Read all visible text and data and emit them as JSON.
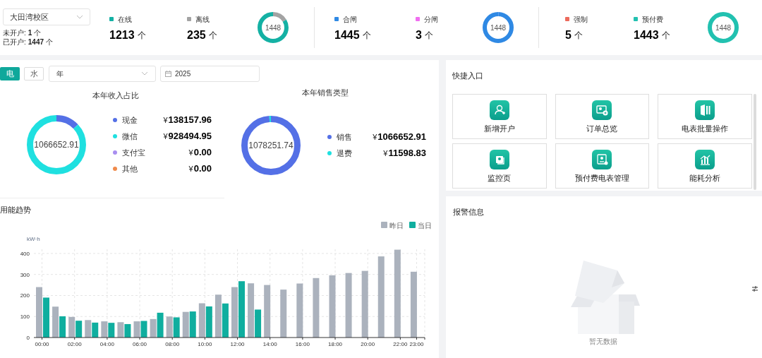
{
  "top_bar": {
    "campus_select": {
      "value": "大田湾校区"
    },
    "account_counts": [
      {
        "label": "未开户:",
        "count": "1",
        "unit": "个"
      },
      {
        "label": "已开户:",
        "count": "1447",
        "unit": "个"
      }
    ],
    "stat_groups": [
      {
        "items": [
          {
            "label": "在线",
            "color": "#14b1a4",
            "value": "1213",
            "unit": "个"
          },
          {
            "label": "离线",
            "color": "#a3a3a3",
            "value": "235",
            "unit": "个"
          }
        ],
        "donut_center": "1448"
      },
      {
        "items": [
          {
            "label": "合闸",
            "color": "#2f89e4",
            "value": "1445",
            "unit": "个"
          },
          {
            "label": "分闸",
            "color": "#f06ef0",
            "value": "3",
            "unit": "个"
          }
        ],
        "donut_center": "1448"
      },
      {
        "items": [
          {
            "label": "强制",
            "color": "#ec6a5c",
            "value": "5",
            "unit": "个"
          },
          {
            "label": "预付费",
            "color": "#22c1b0",
            "value": "1443",
            "unit": "个"
          }
        ],
        "donut_center": "1448"
      }
    ]
  },
  "filters": {
    "energy_tabs": [
      {
        "label": "电",
        "selected": true
      },
      {
        "label": "水",
        "selected": false
      }
    ],
    "period_select": {
      "value": "年"
    },
    "date_field": {
      "value": "2025"
    }
  },
  "income_share": {
    "title": "本年收入占比",
    "center": "1066652.91",
    "items": [
      {
        "label": "现金",
        "color": "#5470e6",
        "currency": "¥",
        "amount": "138157.96"
      },
      {
        "label": "微信",
        "color": "#1fe0e0",
        "currency": "¥",
        "amount": "928494.95"
      },
      {
        "label": "支付宝",
        "color": "#a98ef0",
        "currency": "¥",
        "amount": "0.00"
      },
      {
        "label": "其他",
        "color": "#f08a4b",
        "currency": "¥",
        "amount": "0.00"
      }
    ]
  },
  "sales_type": {
    "title": "本年销售类型",
    "center": "1078251.74",
    "items": [
      {
        "label": "销售",
        "color": "#5470e6",
        "currency": "¥",
        "amount": "1066652.91"
      },
      {
        "label": "退费",
        "color": "#1fe0e0",
        "currency": "¥",
        "amount": "11598.83"
      }
    ]
  },
  "energy_trend": {
    "title": "用能趋势",
    "chart_data": {
      "type": "bar",
      "ylabel": "kW·h",
      "x": [
        0,
        1,
        2,
        3,
        4,
        5,
        6,
        7,
        8,
        9,
        10,
        11,
        12,
        13,
        14,
        15,
        16,
        17,
        18,
        19,
        20,
        21,
        22,
        23
      ],
      "xlim": [
        -0.5,
        23.5
      ],
      "ylim": [
        0,
        420
      ],
      "grid": {
        "x": true,
        "y": true
      },
      "legend": true,
      "yticks": [
        0,
        100,
        200,
        300,
        400
      ],
      "xticks": [
        {
          "value": 0,
          "label": "00:00"
        },
        {
          "value": 2,
          "label": "02:00"
        },
        {
          "value": 4,
          "label": "04:00"
        },
        {
          "value": 6,
          "label": "06:00"
        },
        {
          "value": 8,
          "label": "08:00"
        },
        {
          "value": 10,
          "label": "10:00"
        },
        {
          "value": 12,
          "label": "12:00"
        },
        {
          "value": 14,
          "label": "14:00"
        },
        {
          "value": 16,
          "label": "16:00"
        },
        {
          "value": 18,
          "label": "18:00"
        },
        {
          "value": 20,
          "label": "20:00"
        },
        {
          "value": 22,
          "label": "22:00"
        },
        {
          "value": 23,
          "label": "23:00"
        }
      ],
      "series": [
        {
          "name": "昨日",
          "color": "#abb2bd",
          "values": [
            240,
            147,
            98,
            83,
            77,
            73,
            77,
            88,
            100,
            122,
            163,
            204,
            240,
            258,
            250,
            228,
            257,
            283,
            296,
            307,
            317,
            386,
            418,
            313
          ]
        },
        {
          "name": "当日",
          "color": "#0fae9f",
          "values": [
            190,
            101,
            80,
            71,
            70,
            64,
            79,
            118,
            96,
            124,
            148,
            162,
            268,
            133,
            null,
            null,
            null,
            null,
            null,
            null,
            null,
            null,
            null,
            null
          ]
        }
      ]
    }
  },
  "shortcuts": {
    "title": "快捷入口",
    "items": [
      {
        "label": "新增开户"
      },
      {
        "label": "订单总览"
      },
      {
        "label": "电表批量操作"
      },
      {
        "label": "监控页"
      },
      {
        "label": "预付费电表管理"
      },
      {
        "label": "能耗分析"
      }
    ]
  },
  "alarms": {
    "title": "报警信息",
    "empty_text": "暂无数据"
  }
}
